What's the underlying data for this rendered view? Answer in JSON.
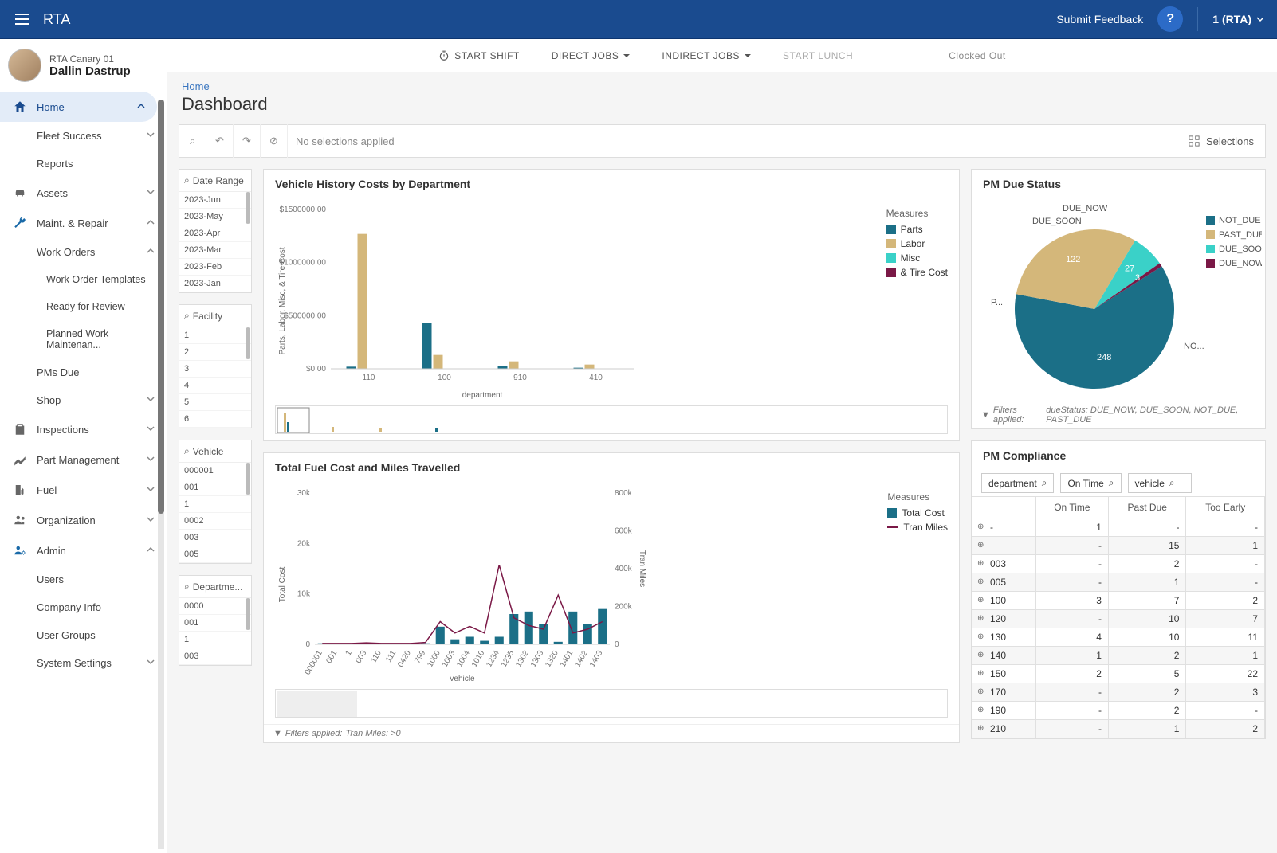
{
  "topbar": {
    "logo": "RTA",
    "feedback": "Submit Feedback",
    "help": "?",
    "account": "1 (RTA)"
  },
  "user": {
    "canary": "RTA Canary 01",
    "name": "Dallin Dastrup"
  },
  "nav": {
    "home": "Home",
    "fleet": "Fleet Success",
    "reports": "Reports",
    "assets": "Assets",
    "maint": "Maint. & Repair",
    "workorders": "Work Orders",
    "wotemplates": "Work Order Templates",
    "ready": "Ready for Review",
    "planned": "Planned Work Maintenan...",
    "pmsdue": "PMs Due",
    "shop": "Shop",
    "inspections": "Inspections",
    "partmgmt": "Part Management",
    "fuel": "Fuel",
    "org": "Organization",
    "admin": "Admin",
    "users": "Users",
    "company": "Company Info",
    "usergroups": "User Groups",
    "syssettings": "System Settings"
  },
  "shiftbar": {
    "start": "START SHIFT",
    "direct": "DIRECT JOBS",
    "indirect": "INDIRECT JOBS",
    "lunch": "START LUNCH",
    "clocked": "Clocked Out"
  },
  "breadcrumb": "Home",
  "pagetitle": "Dashboard",
  "filterbar": {
    "noselect": "No selections applied",
    "selections": "Selections"
  },
  "filters": {
    "dateRange": {
      "label": "Date Range",
      "items": [
        "2023-Jun",
        "2023-May",
        "2023-Apr",
        "2023-Mar",
        "2023-Feb",
        "2023-Jan"
      ]
    },
    "facility": {
      "label": "Facility",
      "items": [
        "1",
        "2",
        "3",
        "4",
        "5",
        "6"
      ]
    },
    "vehicle": {
      "label": "Vehicle",
      "items": [
        "000001",
        "001",
        "1",
        "0002",
        "003",
        "005"
      ]
    },
    "department": {
      "label": "Departme...",
      "items": [
        "0000",
        "001",
        "1",
        "003"
      ]
    }
  },
  "chart_data": [
    {
      "id": "vhcosts",
      "title": "Vehicle History Costs by Department",
      "type": "bar",
      "xlabel": "department",
      "ylabel": "Parts, Labor, Misc, & Tire Cost",
      "ylim": [
        0,
        1500000
      ],
      "yticks": [
        "$0.00",
        "$500000.00",
        "$1000000.00",
        "$1500000.00"
      ],
      "categories": [
        "110",
        "100",
        "910",
        "410"
      ],
      "legend_title": "Measures",
      "series": [
        {
          "name": "Parts",
          "color": "#1b6f87",
          "values": [
            20000,
            430000,
            30000,
            10000
          ]
        },
        {
          "name": "Labor",
          "color": "#d4b77a",
          "values": [
            1270000,
            130000,
            70000,
            40000
          ]
        },
        {
          "name": "Misc",
          "color": "#3ad1c8",
          "values": [
            0,
            0,
            0,
            0
          ]
        },
        {
          "name": "& Tire Cost",
          "color": "#7a1846",
          "values": [
            0,
            0,
            0,
            0
          ]
        }
      ]
    },
    {
      "id": "fuelmiles",
      "title": "Total Fuel Cost and Miles Travelled",
      "type": "bar_line",
      "xlabel": "vehicle",
      "ylabel": "Total Cost",
      "y2label": "Tran Miles",
      "ylim": [
        0,
        30000
      ],
      "yticks": [
        "0",
        "10k",
        "20k",
        "30k"
      ],
      "y2lim": [
        0,
        800000
      ],
      "y2ticks": [
        "0",
        "200k",
        "400k",
        "600k",
        "800k"
      ],
      "categories": [
        "000001",
        "001",
        "1",
        "003",
        "110",
        "111",
        "0420",
        "799",
        "1000",
        "1003",
        "1004",
        "1010",
        "1234",
        "1235",
        "1302",
        "1303",
        "1320",
        "1401",
        "1402",
        "1403"
      ],
      "series": [
        {
          "name": "Total Cost",
          "type": "bar",
          "color": "#1b6f87",
          "values": [
            200,
            200,
            200,
            200,
            200,
            200,
            200,
            200,
            3500,
            1000,
            1500,
            700,
            1500,
            6000,
            6500,
            4000,
            500,
            6500,
            4000,
            7000
          ]
        },
        {
          "name": "Tran Miles",
          "type": "line",
          "color": "#7a1846",
          "values": [
            5000,
            5000,
            5000,
            8000,
            5000,
            5000,
            5000,
            10000,
            120000,
            60000,
            95000,
            60000,
            420000,
            140000,
            100000,
            80000,
            260000,
            60000,
            80000,
            120000
          ]
        }
      ],
      "legend_title": "Measures",
      "filters_applied": "Tran Miles: >0"
    },
    {
      "id": "pmdue",
      "title": "PM Due Status",
      "type": "pie",
      "legend": [
        "NOT_DUE",
        "PAST_DUE",
        "DUE_SOON",
        "DUE_NOW"
      ],
      "colors": {
        "NOT_DUE": "#1b6f87",
        "PAST_DUE": "#d4b77a",
        "DUE_SOON": "#3ad1c8",
        "DUE_NOW": "#7a1846"
      },
      "slices": [
        {
          "name": "NOT_DUE",
          "label": "NO...",
          "value": 248
        },
        {
          "name": "PAST_DUE",
          "label": "P...",
          "value": 122
        },
        {
          "name": "DUE_SOON",
          "label": "DUE_SOON",
          "value": 27
        },
        {
          "name": "DUE_NOW",
          "label": "DUE_NOW",
          "value": 3
        }
      ],
      "filters_applied": "dueStatus: DUE_NOW, DUE_SOON, NOT_DUE, PAST_DUE"
    }
  ],
  "compliance": {
    "title": "PM Compliance",
    "tags": [
      "department",
      "On Time",
      "vehicle"
    ],
    "columns": [
      "",
      "On Time",
      "Past Due",
      "Too Early"
    ],
    "rows": [
      {
        "dept": "-",
        "on": "1",
        "past": "-",
        "early": "-"
      },
      {
        "dept": "",
        "on": "-",
        "past": "15",
        "early": "1"
      },
      {
        "dept": "003",
        "on": "-",
        "past": "2",
        "early": "-"
      },
      {
        "dept": "005",
        "on": "-",
        "past": "1",
        "early": "-"
      },
      {
        "dept": "100",
        "on": "3",
        "past": "7",
        "early": "2"
      },
      {
        "dept": "120",
        "on": "-",
        "past": "10",
        "early": "7"
      },
      {
        "dept": "130",
        "on": "4",
        "past": "10",
        "early": "11"
      },
      {
        "dept": "140",
        "on": "1",
        "past": "2",
        "early": "1"
      },
      {
        "dept": "150",
        "on": "2",
        "past": "5",
        "early": "22"
      },
      {
        "dept": "170",
        "on": "-",
        "past": "2",
        "early": "3"
      },
      {
        "dept": "190",
        "on": "-",
        "past": "2",
        "early": "-"
      },
      {
        "dept": "210",
        "on": "-",
        "past": "1",
        "early": "2"
      }
    ]
  },
  "filters_label": "Filters applied:"
}
